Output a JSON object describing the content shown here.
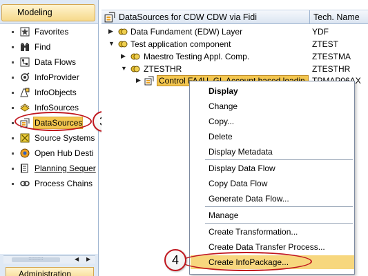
{
  "left_pane": {
    "header": "Modeling",
    "footer_header": "Administration",
    "items": [
      {
        "label": "Favorites",
        "icon": "favorites-icon"
      },
      {
        "label": "Find",
        "icon": "binoculars-icon"
      },
      {
        "label": "Data Flows",
        "icon": "data-flow-icon"
      },
      {
        "label": "InfoProvider",
        "icon": "infoprovider-icon"
      },
      {
        "label": "InfoObjects",
        "icon": "infoobjects-icon"
      },
      {
        "label": "InfoSources",
        "icon": "infosources-icon"
      },
      {
        "label": "DataSources",
        "icon": "datasources-icon",
        "selected": true
      },
      {
        "label": "Source Systems",
        "icon": "source-systems-icon"
      },
      {
        "label": "Open Hub Desti",
        "icon": "open-hub-icon"
      },
      {
        "label": "Planning Sequer",
        "icon": "planning-icon"
      },
      {
        "label": "Process Chains",
        "icon": "process-chains-icon"
      }
    ],
    "scroll_grip": ":::::::::::",
    "scroll_left": "◀",
    "scroll_right": "▶"
  },
  "tree": {
    "title": "DataSources for CDW CDW via Fidi",
    "tech_header": "Tech. Name",
    "rows": [
      {
        "label": "Data Fundament (EDW) Layer",
        "tech": "YDF",
        "arrow": "▶"
      },
      {
        "label": "Test application component",
        "tech": "ZTEST",
        "arrow": "▼"
      },
      {
        "label": "Maestro Testing Appl. Comp.",
        "tech": "ZTESTMA",
        "arrow": "▶"
      },
      {
        "label": "ZTESTHR",
        "tech": "ZTESTHR",
        "arrow": "▼"
      },
      {
        "label": "Control FA4U_GL Account based loadin",
        "tech": "TPMAP06AX",
        "arrow": "▶"
      }
    ]
  },
  "context_menu": {
    "items": [
      {
        "label": "Display",
        "bold": true
      },
      {
        "label": "Change"
      },
      {
        "label": "Copy..."
      },
      {
        "label": "Delete"
      },
      {
        "label": "Display Metadata"
      },
      {
        "label": "Display Data Flow"
      },
      {
        "label": "Copy Data Flow"
      },
      {
        "label": "Generate Data Flow..."
      },
      {
        "label": "Manage"
      },
      {
        "label": "Create Transformation..."
      },
      {
        "label": "Create Data Transfer Process..."
      },
      {
        "label": "Create InfoPackage...",
        "highlighted": true
      }
    ]
  },
  "annotations": {
    "step3": "3",
    "step4": "4",
    "color": "#c0161e"
  },
  "colors": {
    "selection": "#f3c64f",
    "pane_bg": "#dfe9f5"
  }
}
